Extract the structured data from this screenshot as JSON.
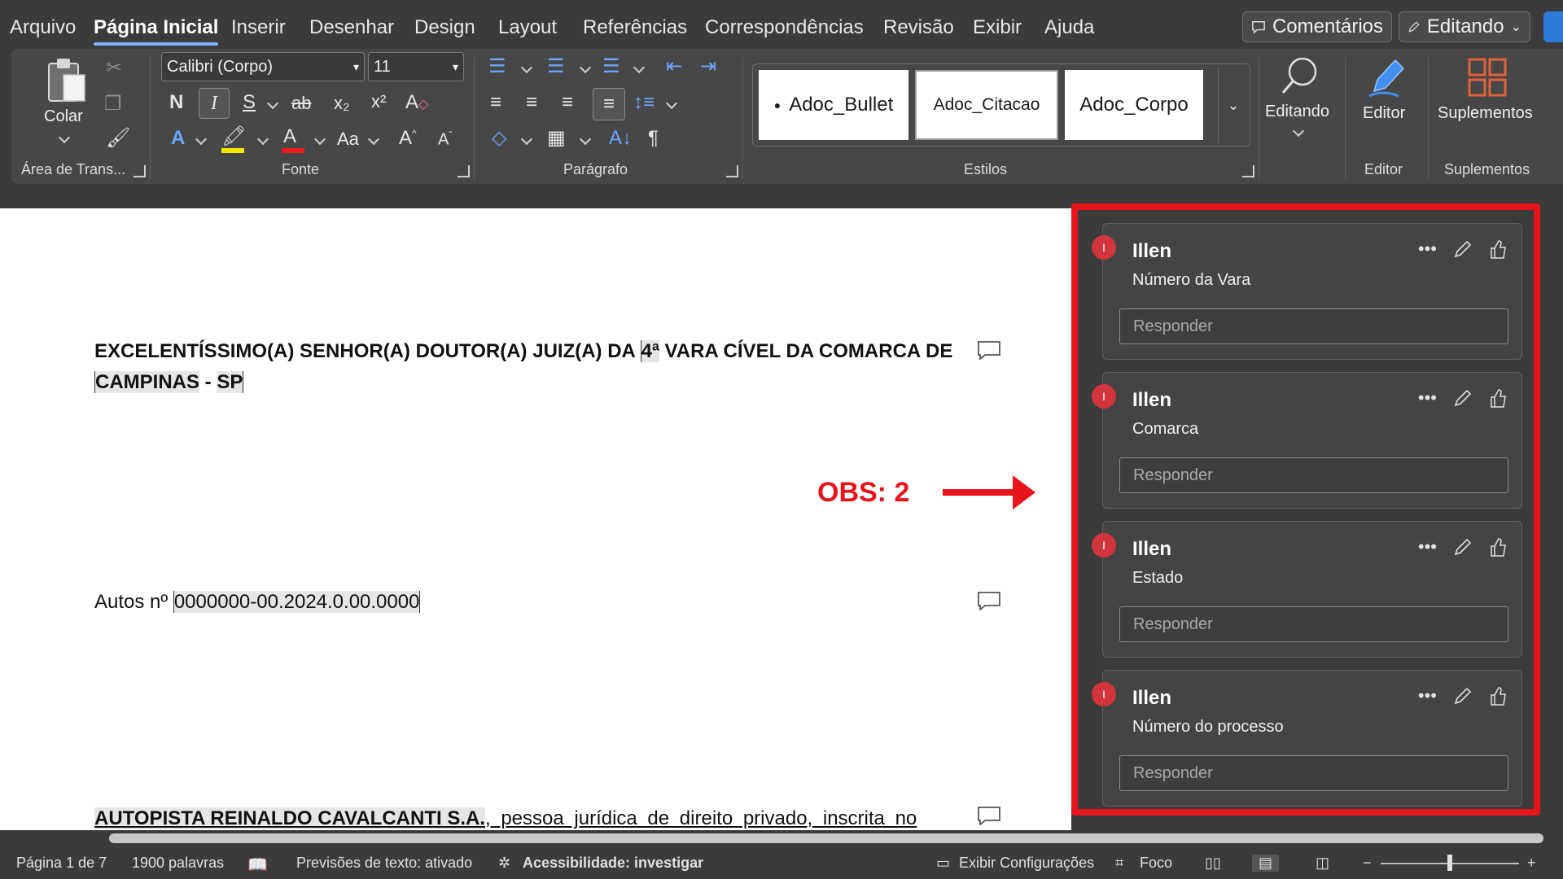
{
  "menu": {
    "tabs": [
      "Arquivo",
      "Página Inicial",
      "Inserir",
      "Desenhar",
      "Design",
      "Layout",
      "Referências",
      "Correspondências",
      "Revisão",
      "Exibir",
      "Ajuda"
    ],
    "comments_button": "Comentários",
    "editing_button": "Editando"
  },
  "ribbon": {
    "clipboard": {
      "paste_label": "Colar",
      "group_label": "Área de Trans..."
    },
    "font": {
      "family": "Calibri (Corpo)",
      "size": "11",
      "bold": "N",
      "italic": "I",
      "underline": "S",
      "strike": "ab",
      "subscript": "x₂",
      "superscript": "x²",
      "case": "Aa",
      "group_label": "Fonte"
    },
    "paragraph": {
      "group_label": "Parágrafo"
    },
    "styles": {
      "items": [
        "Adoc_Bullet",
        "Adoc_Citacao",
        "Adoc_Corpo"
      ],
      "group_label": "Estilos"
    },
    "editing": {
      "label": "Editando"
    },
    "editor": {
      "label": "Editor",
      "group_label": "Editor"
    },
    "addins": {
      "label": "Suplementos",
      "group_label": "Suplementos"
    }
  },
  "document": {
    "heading_line1": "EXCELENTÍSSIMO(A) SENHOR(A) DOUTOR(A) JUIZ(A) DA ",
    "heading_vara": "4ª",
    "heading_line1_rest": " VARA CÍVEL DA COMARCA DE",
    "heading_city": "CAMPINAS",
    "heading_dash": " - ",
    "heading_state": "SP",
    "autos_label": "Autos nº ",
    "autos_number": "0000000-00.2024.0.00.0000",
    "party_name": "AUTOPISTA REINALDO CAVALCANTI S.A.",
    "party_rest": ", pessoa jurídica de direito privado, inscrita no"
  },
  "annotation": {
    "label": "OBS: 2"
  },
  "comments": [
    {
      "author": "Illen",
      "initial": "I",
      "text": "Número da Vara",
      "reply_placeholder": "Responder"
    },
    {
      "author": "Illen",
      "initial": "I",
      "text": "Comarca",
      "reply_placeholder": "Responder"
    },
    {
      "author": "Illen",
      "initial": "I",
      "text": "Estado",
      "reply_placeholder": "Responder"
    },
    {
      "author": "Illen",
      "initial": "I",
      "text": "Número do processo",
      "reply_placeholder": "Responder"
    }
  ],
  "status": {
    "page": "Página 1 de 7",
    "words": "1900 palavras",
    "predictions": "Previsões de texto: ativado",
    "accessibility": "Acessibilidade: investigar",
    "display_settings": "Exibir Configurações",
    "focus": "Foco"
  },
  "colors": {
    "highlight_red": "#e8141c",
    "avatar": "#d1343a",
    "accent_blue": "#7fb2ff"
  }
}
